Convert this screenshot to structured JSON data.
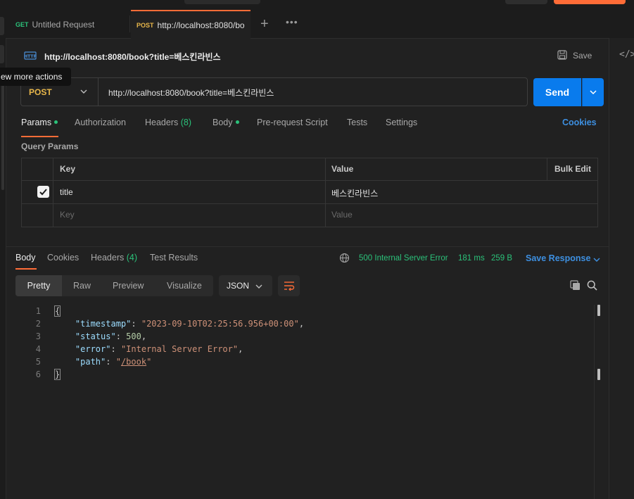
{
  "tabs": [
    {
      "method": "GET",
      "label": "Untitled Request"
    },
    {
      "method": "POST",
      "label": "http://localhost:8080/bo"
    }
  ],
  "tab_actions": {
    "new": "+",
    "more": "•••"
  },
  "request": {
    "title": "http://localhost:8080/book?title=베스킨라빈스",
    "save_label": "Save",
    "method": "POST",
    "url": "http://localhost:8080/book?title=베스킨라빈스",
    "send_label": "Send"
  },
  "tooltip": "ew more actions",
  "request_tabs": [
    {
      "label": "Params",
      "dot": true
    },
    {
      "label": "Authorization"
    },
    {
      "label": "Headers",
      "count": "(8)"
    },
    {
      "label": "Body",
      "dot": true
    },
    {
      "label": "Pre-request Script"
    },
    {
      "label": "Tests"
    },
    {
      "label": "Settings"
    }
  ],
  "cookies_label": "Cookies",
  "query_params": {
    "title": "Query Params",
    "headers": {
      "key": "Key",
      "value": "Value",
      "bulk_edit": "Bulk Edit"
    },
    "rows": [
      {
        "key": "title",
        "value": "베스킨라빈스",
        "checked": true
      }
    ],
    "placeholder": {
      "key": "Key",
      "value": "Value"
    }
  },
  "response": {
    "tabs": [
      {
        "label": "Body"
      },
      {
        "label": "Cookies"
      },
      {
        "label": "Headers",
        "count": "(4)"
      },
      {
        "label": "Test Results"
      }
    ],
    "status": "500 Internal Server Error",
    "time": "181 ms",
    "size": "259 B",
    "save_label": "Save Response",
    "views": [
      "Pretty",
      "Raw",
      "Preview",
      "Visualize"
    ],
    "format": "JSON",
    "line_numbers": [
      "1",
      "2",
      "3",
      "4",
      "5",
      "6"
    ],
    "body": {
      "open": "{",
      "close": "}",
      "timestamp_key": "\"timestamp\"",
      "timestamp_val": "\"2023-09-10T02:25:56.956+00:00\"",
      "status_key": "\"status\"",
      "status_val": "500",
      "error_key": "\"error\"",
      "error_val": "\"Internal Server Error\"",
      "path_key": "\"path\"",
      "path_q1": "\"",
      "path_val": "/book",
      "path_q2": "\""
    }
  },
  "colors": {
    "accent": "#ff6c37",
    "send": "#097bed",
    "success": "#2bc27a",
    "link": "#3d8fe0",
    "post": "#e8b74a"
  }
}
